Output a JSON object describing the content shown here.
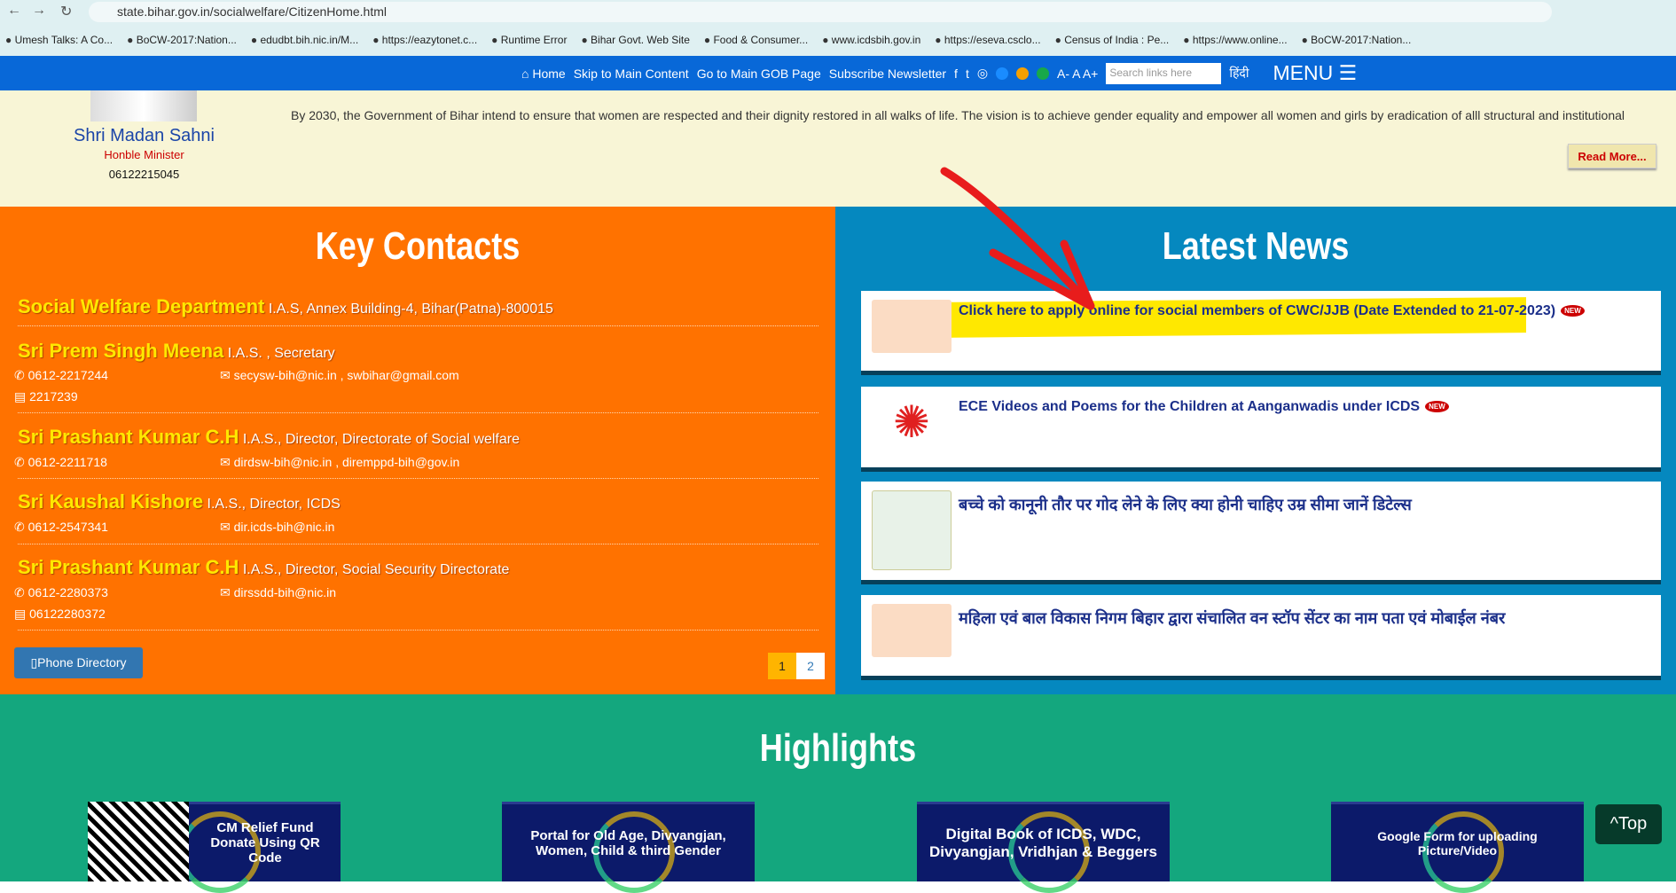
{
  "browser": {
    "url": "state.bihar.gov.in/socialwelfare/CitizenHome.html",
    "bookmarks": [
      "Umesh Talks: A Co...",
      "BoCW-2017:Nation...",
      "edudbt.bih.nic.in/M...",
      "https://eazytonet.c...",
      "Runtime Error",
      "Bihar Govt. Web Site",
      "Food & Consumer...",
      "www.icdsbih.gov.in",
      "https://eseva.csclo...",
      "Census of India : Pe...",
      "https://www.online...",
      "BoCW-2017:Nation..."
    ]
  },
  "nav": {
    "home": "Home",
    "skip": "Skip to Main Content",
    "gob": "Go to Main GOB Page",
    "newsletter": "Subscribe Newsletter",
    "font_size": "A- A A+",
    "search_placeholder": "Search links here",
    "hindi": "हिंदी",
    "menu": "MENU"
  },
  "minister": {
    "name": "Shri Madan Sahni",
    "role": "Honble Minister",
    "phone": "06122215045"
  },
  "vision": "By 2030, the Government of Bihar intend to ensure that women are respected and their dignity restored in all walks of life. The vision is to achieve gender equality and empower all women and girls by eradication of alll structural and institutional",
  "read_more": "Read More...",
  "contacts": {
    "title": "Key Contacts",
    "department": {
      "name": "Social Welfare Department",
      "desc": "I.A.S, Annex Building-4, Bihar(Patna)-800015"
    },
    "people": [
      {
        "name": "Sri Prem Singh Meena",
        "desc": "I.A.S. , Secretary",
        "phone": "0612-2217244",
        "email": "secysw-bih@nic.in , swbihar@gmail.com",
        "fax": "2217239"
      },
      {
        "name": "Sri Prashant Kumar C.H",
        "desc": "I.A.S., Director, Directorate of Social welfare",
        "phone": "0612-2211718",
        "email": "dirdsw-bih@nic.in , diremppd-bih@gov.in"
      },
      {
        "name": "Sri Kaushal Kishore",
        "desc": "I.A.S., Director, ICDS",
        "phone": "0612-2547341",
        "email": "dir.icds-bih@nic.in"
      },
      {
        "name": "Sri Prashant Kumar C.H",
        "desc": "I.A.S., Director, Social Security Directorate",
        "phone": "0612-2280373",
        "email": "dirssdd-bih@nic.in",
        "fax": "06122280372"
      }
    ],
    "phone_directory": "Phone Directory",
    "pages": [
      "1",
      "2"
    ]
  },
  "news": {
    "title": "Latest News",
    "new_badge": "NEW",
    "items": [
      "Click here to apply online for social members of CWC/JJB (Date Extended to 21-07-2023)",
      "ECE Videos and Poems for the Children at Aanganwadis under ICDS",
      "बच्चे को कानूनी तौर पर गोद लेने के लिए क्या होनी चाहिए उम्र सीमा जानें डिटेल्स",
      "महिला एवं बाल विकास निगम बिहार द्वारा संचालित वन स्टॉप सेंटर का नाम पता एवं मोबाईल नंबर"
    ]
  },
  "highlights": {
    "title": "Highlights",
    "items": [
      "CM Relief Fund Donate Using QR Code",
      "Portal for Old Age, Divyangjan, Women, Child & third Gender",
      "Digital Book of ICDS, WDC, Divyangjan, Vridhjan & Beggers",
      "Google Form for uploading Picture/Video"
    ],
    "top": "^Top"
  },
  "colors": {
    "nav": "#0868d8",
    "orange": "#ff7200",
    "news_bg": "#0588bf",
    "green": "#14a77e",
    "highlight_yellow": "#ffe800"
  }
}
